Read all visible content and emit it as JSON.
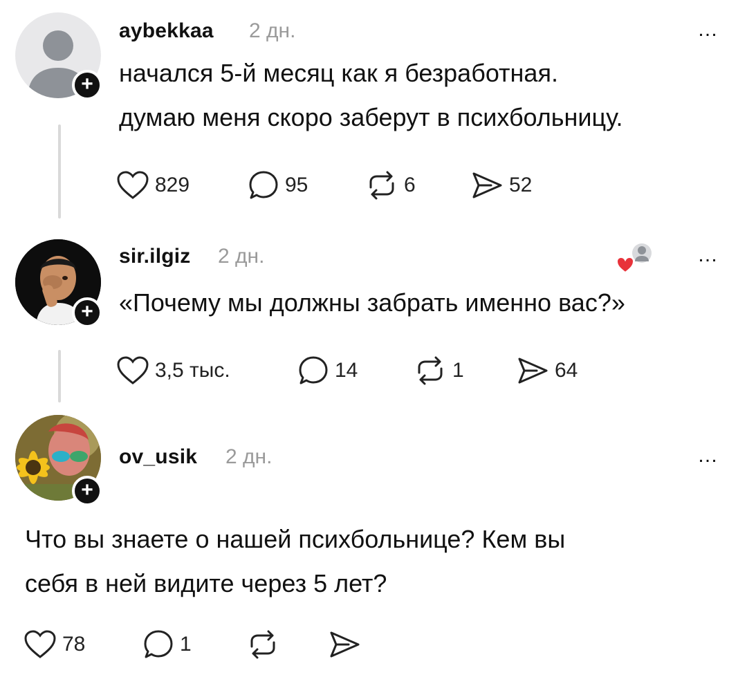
{
  "posts": [
    {
      "username": "aybekkaa",
      "time": "2 дн.",
      "more": "…",
      "text_lines": [
        "начался 5-й месяц как я безработная.",
        "думаю меня скоро заберут в психбольницу."
      ],
      "likes": "829",
      "replies": "95",
      "reposts": "6",
      "shares": "52"
    },
    {
      "username": "sir.ilgiz",
      "time": "2 дн.",
      "more": "…",
      "text_lines": [
        "«Почему мы должны забрать именно вас?»"
      ],
      "likes": "3,5 тыс.",
      "replies": "14",
      "reposts": "1",
      "shares": "64"
    },
    {
      "username": "ov_usik",
      "time": "2 дн.",
      "more": "…",
      "text_lines": [
        "Что вы знаете о нашей психбольнице? Кем вы",
        "себя в ней видите через 5 лет?"
      ],
      "likes": "78",
      "replies": "1",
      "reposts": "",
      "shares": ""
    }
  ],
  "colors": {
    "heart_badge": "#e8323a",
    "muted": "#9a9a9a",
    "text": "#111111"
  }
}
